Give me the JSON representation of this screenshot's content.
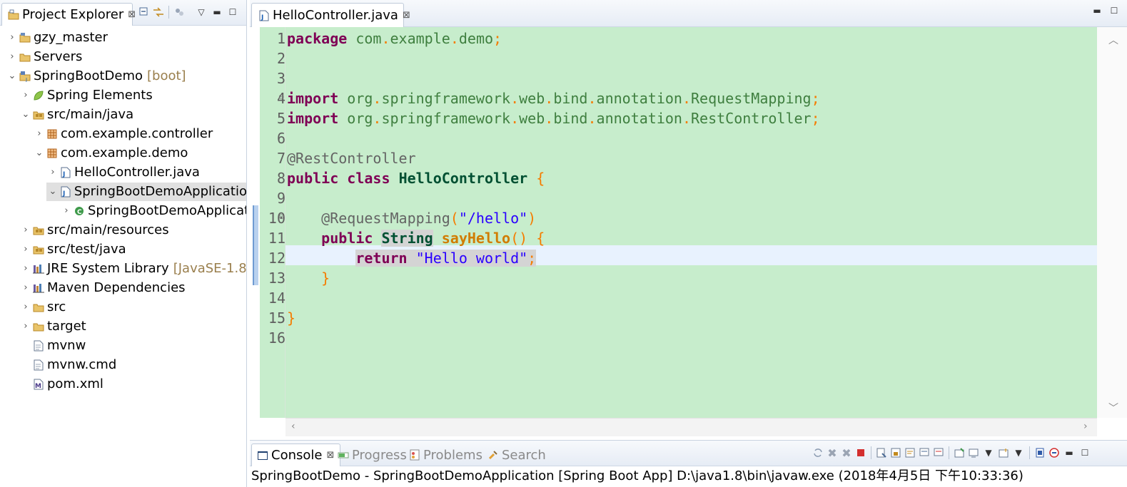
{
  "explorer": {
    "title": "Project Explorer",
    "close": "⊠",
    "tree": [
      {
        "label": "gzy_master",
        "decor": "",
        "icon": "project-folder-icon",
        "chev": "›"
      },
      {
        "label": "Servers",
        "decor": "",
        "icon": "folder-icon",
        "chev": "›"
      },
      {
        "label": "SpringBootDemo",
        "decor": "[boot]",
        "icon": "java-project-icon",
        "chev": "⌄"
      },
      {
        "label": "Spring Elements",
        "decor": "",
        "icon": "spring-leaf-icon",
        "chev": "›"
      },
      {
        "label": "src/main/java",
        "decor": "",
        "icon": "source-folder-icon",
        "chev": "⌄"
      },
      {
        "label": "com.example.controller",
        "decor": "",
        "icon": "package-icon",
        "chev": "›"
      },
      {
        "label": "com.example.demo",
        "decor": "",
        "icon": "package-icon",
        "chev": "⌄"
      },
      {
        "label": "HelloController.java",
        "decor": "",
        "icon": "java-file-icon",
        "chev": "›"
      },
      {
        "label": "SpringBootDemoApplicatio",
        "decor": "",
        "icon": "java-file-icon",
        "chev": "⌄"
      },
      {
        "label": "SpringBootDemoApplicat",
        "decor": "",
        "icon": "spring-class-icon",
        "chev": "›"
      },
      {
        "label": "src/main/resources",
        "decor": "",
        "icon": "source-folder-icon",
        "chev": "›"
      },
      {
        "label": "src/test/java",
        "decor": "",
        "icon": "source-folder-icon",
        "chev": "›"
      },
      {
        "label": "JRE System Library",
        "decor": "[JavaSE-1.8]",
        "icon": "library-icon",
        "chev": "›"
      },
      {
        "label": "Maven Dependencies",
        "decor": "",
        "icon": "library-icon",
        "chev": "›"
      },
      {
        "label": "src",
        "decor": "",
        "icon": "folder-icon",
        "chev": "›"
      },
      {
        "label": "target",
        "decor": "",
        "icon": "folder-icon",
        "chev": "›"
      },
      {
        "label": "mvnw",
        "decor": "",
        "icon": "file-icon",
        "chev": ""
      },
      {
        "label": "mvnw.cmd",
        "decor": "",
        "icon": "file-icon",
        "chev": ""
      },
      {
        "label": "pom.xml",
        "decor": "",
        "icon": "maven-file-icon",
        "chev": ""
      }
    ]
  },
  "editor": {
    "tab_title": "HelloController.java",
    "close": "⊠",
    "line_numbers": [
      "1",
      "2",
      "3",
      "4",
      "5",
      "6",
      "7",
      "8",
      "9",
      "10",
      "11",
      "12",
      "13",
      "14",
      "15",
      "16"
    ],
    "code": {
      "package_kw": "package",
      "pkg_com": "com",
      "pkg_example": "example",
      "pkg_demo": "demo",
      "import_kw": "import",
      "p_org": "org",
      "p_springframework": "springframework",
      "p_web": "web",
      "p_bind": "bind",
      "p_annotation": "annotation",
      "cls_request_mapping": "RequestMapping",
      "cls_rest_controller": "RestController",
      "ann_rest_controller": "@RestController",
      "public_kw": "public",
      "class_kw": "class",
      "class_name": "HelloController",
      "ann_request_mapping": "@RequestMapping",
      "str_hello_path": "\"/hello\"",
      "type_string": "String",
      "method_name": "sayHello",
      "return_kw": "return",
      "str_hello_world": "\"Hello world\""
    }
  },
  "console": {
    "tabs": [
      {
        "label": "Console",
        "icon": "console-icon"
      },
      {
        "label": "Progress",
        "icon": "progress-icon"
      },
      {
        "label": "Problems",
        "icon": "problems-icon"
      },
      {
        "label": "Search",
        "icon": "search-icon"
      }
    ],
    "close": "⊠",
    "output": "SpringBootDemo - SpringBootDemoApplication [Spring Boot App] D:\\java1.8\\bin\\javaw.exe (2018年4月5日 下午10:33:36)"
  },
  "colors": {
    "editor_bg": "#c7edcc",
    "keyword": "#7f0055",
    "string": "#2a00ff",
    "annotation": "#646464"
  }
}
